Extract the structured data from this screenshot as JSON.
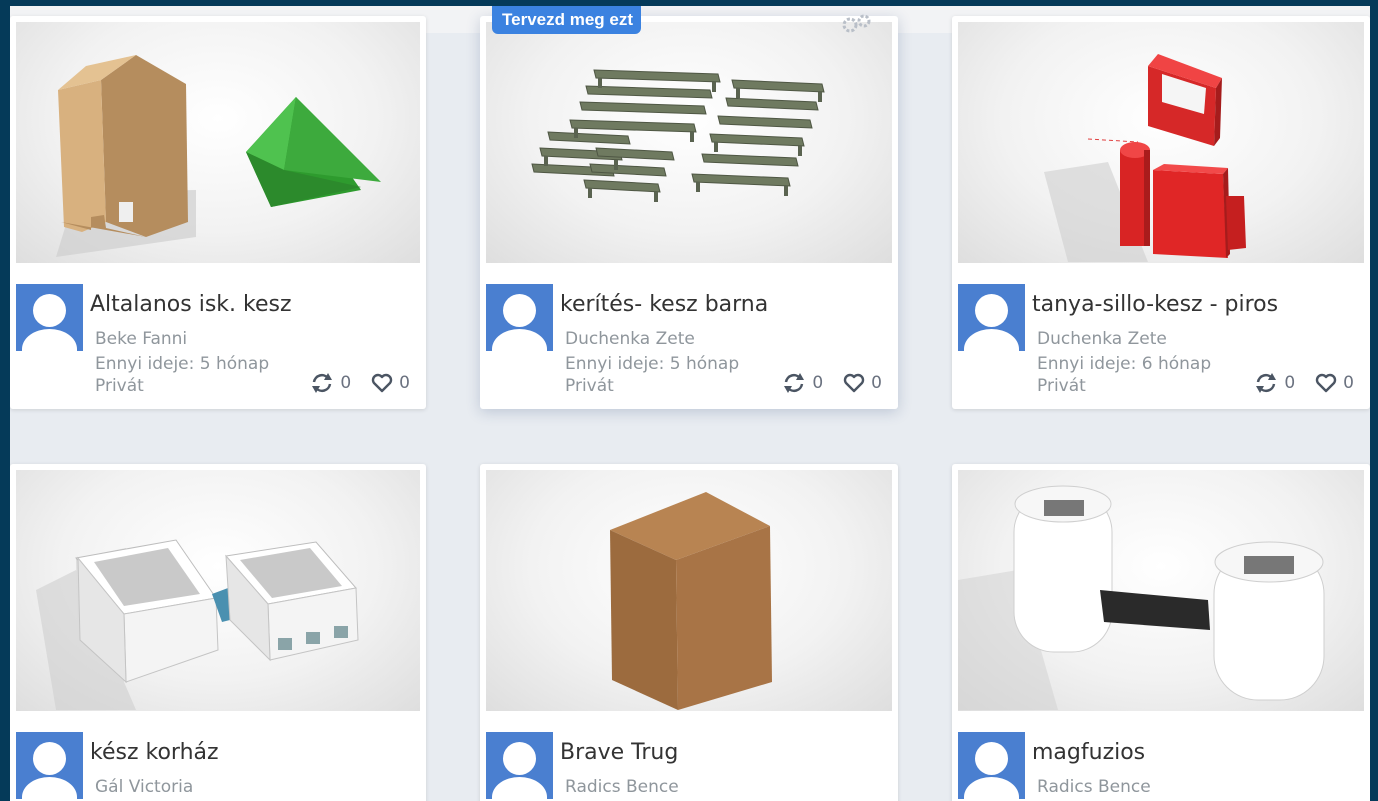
{
  "colors": {
    "background": "#053a59",
    "avatar": "#4a7fd0",
    "tag": "#3b82e0"
  },
  "tag_label": "Tervezd meg ezt",
  "cards": [
    {
      "title": "Altalanos isk. kesz",
      "author": "Beke Fanni",
      "age": "Ennyi ideje: 5 hónap",
      "visibility": "Privát",
      "remixes": "0",
      "likes": "0"
    },
    {
      "title": "kerítés- kesz barna",
      "author": "Duchenka Zete",
      "age": "Ennyi ideje: 5 hónap",
      "visibility": "Privát",
      "remixes": "0",
      "likes": "0"
    },
    {
      "title": "tanya-sillo-kesz - piros",
      "author": "Duchenka Zete",
      "age": "Ennyi ideje: 6 hónap",
      "visibility": "Privát",
      "remixes": "0",
      "likes": "0"
    },
    {
      "title": "kész korház",
      "author": "Gál Victoria"
    },
    {
      "title": "Brave Trug",
      "author": "Radics Bence"
    },
    {
      "title": "magfuzios",
      "author": "Radics Bence"
    }
  ]
}
